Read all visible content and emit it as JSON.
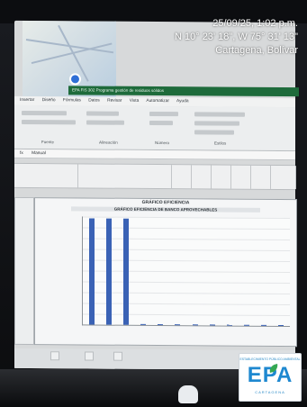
{
  "overlay": {
    "datetime": "25/09/25, 1:02 p.m.",
    "coords": "N 10° 23' 18\", W 75° 31' 13\"",
    "location": "Cartagena, Bolívar"
  },
  "excel": {
    "title": "EPA FIS 302 Programa gestión de residuos sólidos",
    "tabs": [
      "Insertar",
      "Diseño",
      "Fórmulas",
      "Datos",
      "Revisar",
      "Vista",
      "Automatizar",
      "Ayuda"
    ],
    "groups": [
      "Fuente",
      "Alineación",
      "Número",
      "Estilos"
    ],
    "formula_cell": "Manual"
  },
  "chart": {
    "title": "GRÁFICO EFICIENCIA",
    "subtitle": "GRÁFICO EFICIENCIA DE BANCO APROVECHABLES"
  },
  "chart_data": {
    "type": "bar",
    "title": "GRÁFICO EFICIENCIA",
    "subtitle": "GRÁFICO EFICIENCIA DE BANCO APROVECHABLES",
    "series": [
      {
        "values": [
          100,
          100,
          100,
          0,
          0,
          0,
          0,
          0,
          0,
          0,
          0,
          0
        ]
      }
    ],
    "ylim": [
      0,
      100
    ],
    "grid": true
  },
  "logo": {
    "top": "ESTABLECIMIENTO PÚBLICO AMBIENTAL",
    "name": "EPA",
    "bottom": "CARTAGENA"
  },
  "colors": {
    "bar": "#3a62b5",
    "excel_green": "#1e6b3b",
    "logo_blue": "#1e88d0",
    "logo_green": "#34a853"
  }
}
